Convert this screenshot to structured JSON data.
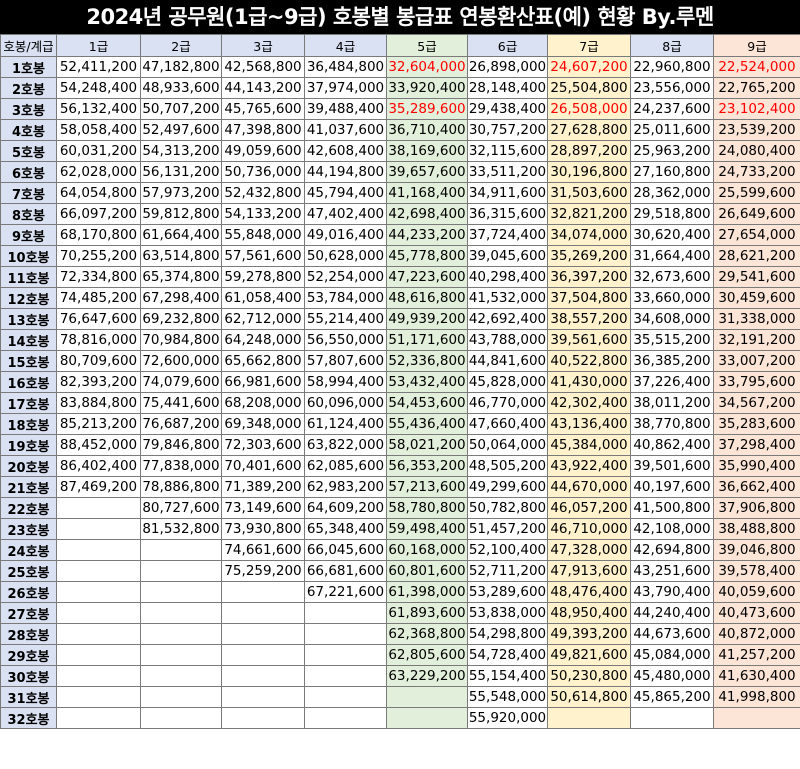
{
  "title": "2024년 공무원(1급~9급) 호봉별 봉급표 연봉환산표(예) 현황 By.루멘",
  "header": [
    "호봉/계급",
    "1급",
    "2급",
    "3급",
    "4급",
    "5급",
    "6급",
    "7급",
    "8급",
    "9급"
  ],
  "colors": {
    "grade5": "#e2efda",
    "grade7": "#fff2cc",
    "grade9": "#fce4d6",
    "label": "#d9e1f2",
    "highlight": "#ff0000"
  },
  "rows": [
    [
      "1호봉",
      "52,411,200",
      "47,182,800",
      "42,568,800",
      "36,484,800",
      "32,604,000",
      "26,898,000",
      "24,607,200",
      "22,960,800",
      "22,524,000"
    ],
    [
      "2호봉",
      "54,248,400",
      "48,933,600",
      "44,143,200",
      "37,974,000",
      "33,920,400",
      "28,148,400",
      "25,504,800",
      "23,556,000",
      "22,765,200"
    ],
    [
      "3호봉",
      "56,132,400",
      "50,707,200",
      "45,765,600",
      "39,488,400",
      "35,289,600",
      "29,438,400",
      "26,508,000",
      "24,237,600",
      "23,102,400"
    ],
    [
      "4호봉",
      "58,058,400",
      "52,497,600",
      "47,398,800",
      "41,037,600",
      "36,710,400",
      "30,757,200",
      "27,628,800",
      "25,011,600",
      "23,539,200"
    ],
    [
      "5호봉",
      "60,031,200",
      "54,313,200",
      "49,059,600",
      "42,608,400",
      "38,169,600",
      "32,115,600",
      "28,897,200",
      "25,963,200",
      "24,080,400"
    ],
    [
      "6호봉",
      "62,028,000",
      "56,131,200",
      "50,736,000",
      "44,194,800",
      "39,657,600",
      "33,511,200",
      "30,196,800",
      "27,160,800",
      "24,733,200"
    ],
    [
      "7호봉",
      "64,054,800",
      "57,973,200",
      "52,432,800",
      "45,794,400",
      "41,168,400",
      "34,911,600",
      "31,503,600",
      "28,362,000",
      "25,599,600"
    ],
    [
      "8호봉",
      "66,097,200",
      "59,812,800",
      "54,133,200",
      "47,402,400",
      "42,698,400",
      "36,315,600",
      "32,821,200",
      "29,518,800",
      "26,649,600"
    ],
    [
      "9호봉",
      "68,170,800",
      "61,664,400",
      "55,848,000",
      "49,016,400",
      "44,233,200",
      "37,724,400",
      "34,074,000",
      "30,620,400",
      "27,654,000"
    ],
    [
      "10호봉",
      "70,255,200",
      "63,514,800",
      "57,561,600",
      "50,628,000",
      "45,778,800",
      "39,045,600",
      "35,269,200",
      "31,664,400",
      "28,621,200"
    ],
    [
      "11호봉",
      "72,334,800",
      "65,374,800",
      "59,278,800",
      "52,254,000",
      "47,223,600",
      "40,298,400",
      "36,397,200",
      "32,673,600",
      "29,541,600"
    ],
    [
      "12호봉",
      "74,485,200",
      "67,298,400",
      "61,058,400",
      "53,784,000",
      "48,616,800",
      "41,532,000",
      "37,504,800",
      "33,660,000",
      "30,459,600"
    ],
    [
      "13호봉",
      "76,647,600",
      "69,232,800",
      "62,712,000",
      "55,214,400",
      "49,939,200",
      "42,692,400",
      "38,557,200",
      "34,608,000",
      "31,338,000"
    ],
    [
      "14호봉",
      "78,816,000",
      "70,984,800",
      "64,248,000",
      "56,550,000",
      "51,171,600",
      "43,788,000",
      "39,561,600",
      "35,515,200",
      "32,191,200"
    ],
    [
      "15호봉",
      "80,709,600",
      "72,600,000",
      "65,662,800",
      "57,807,600",
      "52,336,800",
      "44,841,600",
      "40,522,800",
      "36,385,200",
      "33,007,200"
    ],
    [
      "16호봉",
      "82,393,200",
      "74,079,600",
      "66,981,600",
      "58,994,400",
      "53,432,400",
      "45,828,000",
      "41,430,000",
      "37,226,400",
      "33,795,600"
    ],
    [
      "17호봉",
      "83,884,800",
      "75,441,600",
      "68,208,000",
      "60,096,000",
      "54,453,600",
      "46,770,000",
      "42,302,400",
      "38,011,200",
      "34,567,200"
    ],
    [
      "18호봉",
      "85,213,200",
      "76,687,200",
      "69,348,000",
      "61,124,400",
      "55,436,400",
      "47,660,400",
      "43,136,400",
      "38,770,800",
      "35,283,600"
    ],
    [
      "19호봉",
      "88,452,000",
      "79,846,800",
      "72,303,600",
      "63,822,000",
      "58,021,200",
      "50,064,000",
      "45,384,000",
      "40,862,400",
      "37,298,400"
    ],
    [
      "20호봉",
      "86,402,400",
      "77,838,000",
      "70,401,600",
      "62,085,600",
      "56,353,200",
      "48,505,200",
      "43,922,400",
      "39,501,600",
      "35,990,400"
    ],
    [
      "21호봉",
      "87,469,200",
      "78,886,800",
      "71,389,200",
      "62,983,200",
      "57,213,600",
      "49,299,600",
      "44,670,000",
      "40,197,600",
      "36,662,400"
    ],
    [
      "22호봉",
      "",
      "80,727,600",
      "73,149,600",
      "64,609,200",
      "58,780,800",
      "50,782,800",
      "46,057,200",
      "41,500,800",
      "37,906,800"
    ],
    [
      "23호봉",
      "",
      "81,532,800",
      "73,930,800",
      "65,348,400",
      "59,498,400",
      "51,457,200",
      "46,710,000",
      "42,108,000",
      "38,488,800"
    ],
    [
      "24호봉",
      "",
      "",
      "74,661,600",
      "66,045,600",
      "60,168,000",
      "52,100,400",
      "47,328,000",
      "42,694,800",
      "39,046,800"
    ],
    [
      "25호봉",
      "",
      "",
      "75,259,200",
      "66,681,600",
      "60,801,600",
      "52,711,200",
      "47,913,600",
      "43,251,600",
      "39,578,400"
    ],
    [
      "26호봉",
      "",
      "",
      "",
      "67,221,600",
      "61,398,000",
      "53,289,600",
      "48,476,400",
      "43,790,400",
      "40,059,600"
    ],
    [
      "27호봉",
      "",
      "",
      "",
      "",
      "61,893,600",
      "53,838,000",
      "48,950,400",
      "44,240,400",
      "40,473,600"
    ],
    [
      "28호봉",
      "",
      "",
      "",
      "",
      "62,368,800",
      "54,298,800",
      "49,393,200",
      "44,673,600",
      "40,872,000"
    ],
    [
      "29호봉",
      "",
      "",
      "",
      "",
      "62,805,600",
      "54,728,400",
      "49,821,600",
      "45,084,000",
      "41,257,200"
    ],
    [
      "30호봉",
      "",
      "",
      "",
      "",
      "63,229,200",
      "55,154,400",
      "50,230,800",
      "45,480,000",
      "41,630,400"
    ],
    [
      "31호봉",
      "",
      "",
      "",
      "",
      "",
      "55,548,000",
      "50,614,800",
      "45,865,200",
      "41,998,800"
    ],
    [
      "32호봉",
      "",
      "",
      "",
      "",
      "",
      "55,920,000",
      "",
      "",
      ""
    ]
  ],
  "highlighted_cells": [
    [
      0,
      5
    ],
    [
      0,
      7
    ],
    [
      0,
      9
    ],
    [
      2,
      5
    ],
    [
      2,
      7
    ],
    [
      2,
      9
    ]
  ]
}
